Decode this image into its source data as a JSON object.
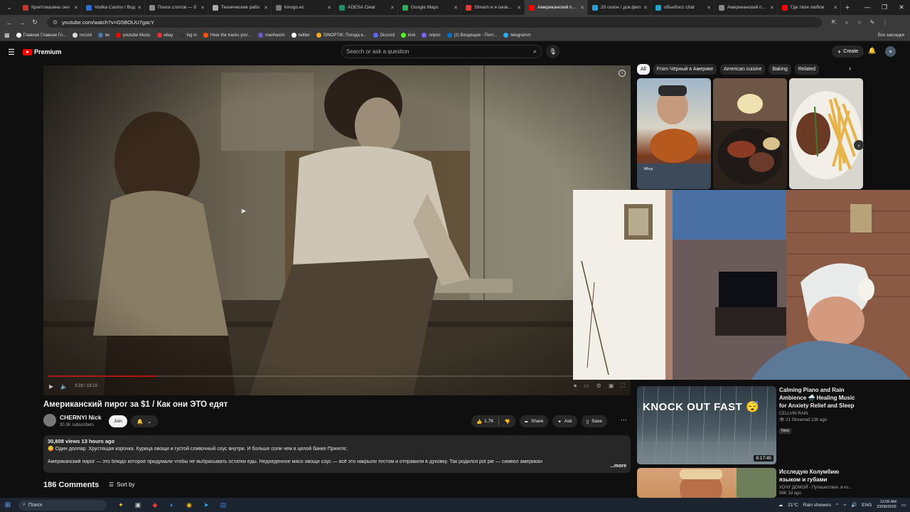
{
  "browser": {
    "tabs": [
      {
        "label": "Криптоказино онл",
        "color": "#c0392b",
        "active": false
      },
      {
        "label": "Vodka Casino / Вод",
        "color": "#2a6fd6",
        "active": false
      },
      {
        "label": "Поиск слотов — б",
        "color": "#888888",
        "active": false
      },
      {
        "label": "Технические рабо",
        "color": "#aaaaaa",
        "active": false
      },
      {
        "label": "kinogo.ec",
        "color": "#777777",
        "active": false
      },
      {
        "label": "ADESA Clear",
        "color": "#1e8e6e",
        "active": false
      },
      {
        "label": "Google Maps",
        "color": "#34a853",
        "active": false
      },
      {
        "label": "Stream и я снова за",
        "color": "#e53935",
        "active": false
      },
      {
        "label": "Американский пиро",
        "color": "#ff0000",
        "active": true
      },
      {
        "label": "20 сезон / док.фил",
        "color": "#2e9bd6",
        "active": false
      },
      {
        "label": "объебосс chat",
        "color": "#27a3d1",
        "active": false
      },
      {
        "label": "Американский пиро",
        "color": "#888888",
        "active": false
      },
      {
        "label": "Где твоя любов",
        "color": "#ff0000",
        "active": false
      }
    ],
    "new_tab": "+",
    "window_controls": {
      "minimize": "—",
      "maximize": "❐",
      "close": "✕"
    },
    "url": "youtube.com/watch?v=G5BOUU7gacY",
    "bookmarks": [
      {
        "label": "Главная Главная Гл...",
        "color": "#ffffff"
      },
      {
        "label": "record",
        "color": "#dddddd"
      },
      {
        "label": "вк",
        "color": "#4a76a8"
      },
      {
        "label": "youtube Music",
        "color": "#ff0000"
      },
      {
        "label": "ebay",
        "color": "#e53238"
      },
      {
        "label": "log in",
        "color": "#333333"
      },
      {
        "label": "Hear the tracks you'...",
        "color": "#ff5500"
      },
      {
        "label": "manhasim",
        "color": "#6a5acd"
      },
      {
        "label": "twitter",
        "color": "#ffffff"
      },
      {
        "label": "SINOPTIK: Погода в...",
        "color": "#f5a623"
      },
      {
        "label": "Discord",
        "color": "#5865f2"
      },
      {
        "label": "kick",
        "color": "#53fc18"
      },
      {
        "label": "опрос",
        "color": "#7b61ff"
      },
      {
        "label": "(2) Входящие - Почт...",
        "color": "#0072c6"
      },
      {
        "label": "telegramm",
        "color": "#2aabee"
      }
    ],
    "all_bookmarks": "Все закладки"
  },
  "youtube": {
    "logo_text": "Premium",
    "search_placeholder": "Search or ask a question",
    "create_label": "Create"
  },
  "video": {
    "time": "3:28 / 18:19",
    "progress_fraction": 0.19,
    "title": "Американский пирог за $1 / Как они ЭТО едят",
    "channel": "CHERNYI Nick",
    "subscribers": "30.3K subscribers",
    "join_label": "Join",
    "likes": "1.7K",
    "share_label": "Share",
    "ask_label": "Ask",
    "save_label": "Save",
    "views_time": "30,808 views  13 hours ago",
    "desc_line1": "😋 Один доллар. Хрустящая корочка. Курица овощи и густой сливочный соус внутри. И больше соли чем в целой банке Принглс.",
    "desc_line2": "Американский пирог — это блюдо которое придумали чтобы не выбрасывать остатки еды. Недоеденное мясо овощи соус — всё это накрыли тестом и отправили в духовку. Так родился pot pie — символ американ",
    "more_label": "...more",
    "comments": "186 Comments",
    "sort_label": "Sort by"
  },
  "sidebar": {
    "chips": [
      "All",
      "From Чёрный в Америке",
      "American cuisine",
      "Baking",
      "Related"
    ],
    "shorts": [
      {
        "handle": "Mhuy"
      },
      {
        "handle": ""
      },
      {
        "handle": ""
      }
    ],
    "recs": [
      {
        "thumb_text": "KNOCK OUT FAST 😴",
        "duration": "8:17:45",
        "title": "Calming Piano and Rain Ambience 🌧️ Healing Music for Anxiety Relief and Sleep",
        "channel": "CELLVIN RAIN",
        "meta": "👁 21  Streamed 13h ago",
        "badge": "New"
      },
      {
        "thumb_text": "",
        "duration": "",
        "title": "Исследую Колумбию языком и губами",
        "channel": "ХОЧУ ДОМОЙ - Путешествия, в ко...",
        "meta": "56K  1d ago",
        "badge": ""
      }
    ]
  },
  "taskbar": {
    "search_placeholder": "Поиск",
    "weather": "21°C",
    "weather_desc": "Rain showers",
    "lang": "ENG",
    "time": "12:06 AM",
    "date": "23/08/2026"
  }
}
